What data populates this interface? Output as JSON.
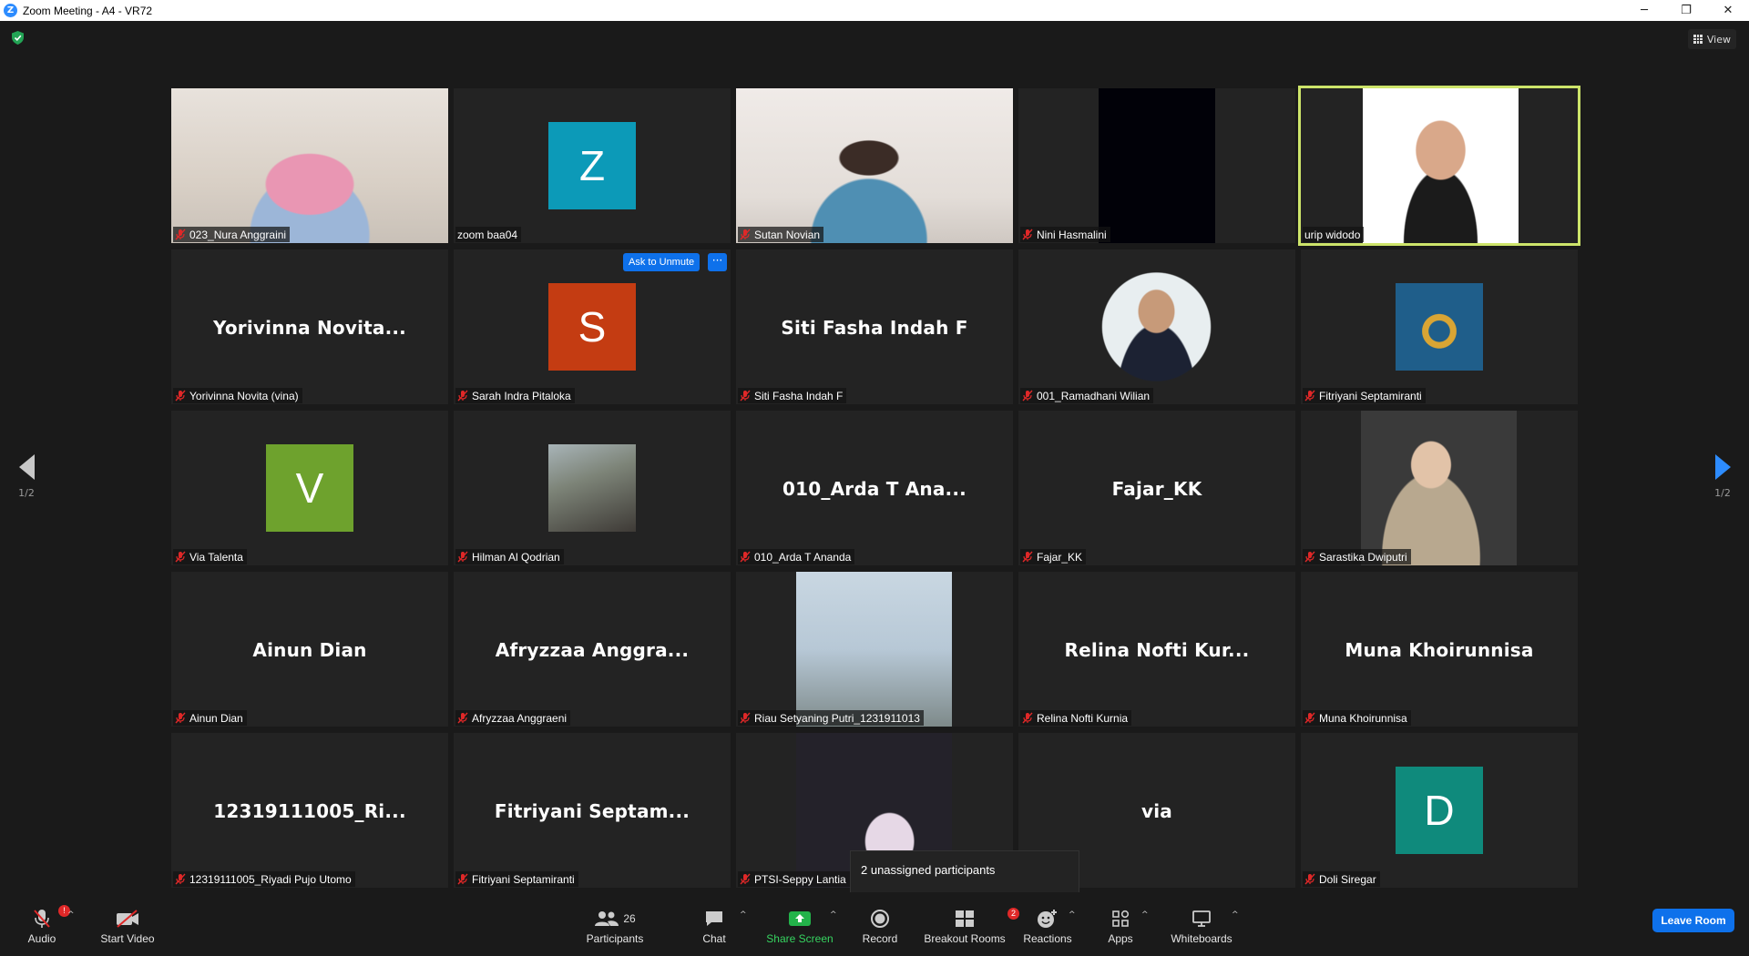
{
  "window": {
    "title": "Zoom Meeting - A4 - VR72",
    "logo_letter": "Z",
    "controls": [
      "─",
      "❐",
      "✕"
    ]
  },
  "view_button": {
    "label": "View"
  },
  "pagination": {
    "left": "1/2",
    "right": "1/2"
  },
  "tiles": [
    {
      "row": 0,
      "col": 0,
      "kind": "photo",
      "label": "023_Nura Anggraini",
      "muted": true
    },
    {
      "row": 0,
      "col": 1,
      "kind": "avatar",
      "letter": "Z",
      "color": "#0c9ab8",
      "label": "zoom baa04",
      "muted": false
    },
    {
      "row": 0,
      "col": 2,
      "kind": "photo",
      "label": "Sutan Novian",
      "muted": true
    },
    {
      "row": 0,
      "col": 3,
      "kind": "photo",
      "label": "Nini Hasmalini",
      "muted": true
    },
    {
      "row": 0,
      "col": 4,
      "kind": "photo",
      "label": "urip widodo",
      "muted": false,
      "active": true
    },
    {
      "row": 1,
      "col": 0,
      "kind": "name",
      "bigname": "Yorivinna  Novita...",
      "label": "Yorivinna Novita (vina)",
      "muted": true
    },
    {
      "row": 1,
      "col": 1,
      "kind": "avatar",
      "letter": "S",
      "color": "#c43c12",
      "label": "Sarah Indra Pitaloka",
      "muted": true
    },
    {
      "row": 1,
      "col": 2,
      "kind": "name",
      "bigname": "Siti Fasha Indah F",
      "label": "Siti Fasha Indah F",
      "muted": true
    },
    {
      "row": 1,
      "col": 3,
      "kind": "photo",
      "label": "001_Ramadhani Wilian",
      "muted": true
    },
    {
      "row": 1,
      "col": 4,
      "kind": "photo",
      "label": "Fitriyani Septamiranti",
      "muted": true
    },
    {
      "row": 2,
      "col": 0,
      "kind": "avatar",
      "letter": "V",
      "color": "#6ea22d",
      "label": "Via Talenta",
      "muted": true
    },
    {
      "row": 2,
      "col": 1,
      "kind": "photo",
      "label": "Hilman Al Qodrian",
      "muted": true
    },
    {
      "row": 2,
      "col": 2,
      "kind": "name",
      "bigname": "010_Arda  T  Ana...",
      "label": "010_Arda T Ananda",
      "muted": true
    },
    {
      "row": 2,
      "col": 3,
      "kind": "name",
      "bigname": "Fajar_KK",
      "label": "Fajar_KK",
      "muted": true
    },
    {
      "row": 2,
      "col": 4,
      "kind": "photo",
      "label": "Sarastika Dwiputri",
      "muted": true
    },
    {
      "row": 3,
      "col": 0,
      "kind": "name",
      "bigname": "Ainun Dian",
      "label": "Ainun Dian",
      "muted": true
    },
    {
      "row": 3,
      "col": 1,
      "kind": "name",
      "bigname": "Afryzzaa  Anggra...",
      "label": "Afryzzaa Anggraeni",
      "muted": true
    },
    {
      "row": 3,
      "col": 2,
      "kind": "photo",
      "label": "Riau Setyaning Putri_1231911013",
      "muted": true
    },
    {
      "row": 3,
      "col": 3,
      "kind": "name",
      "bigname": "Relina  Nofti  Kur...",
      "label": "Relina Nofti Kurnia",
      "muted": true
    },
    {
      "row": 3,
      "col": 4,
      "kind": "name",
      "bigname": "Muna Khoirunnisa",
      "label": "Muna Khoirunnisa",
      "muted": true
    },
    {
      "row": 4,
      "col": 0,
      "kind": "name",
      "bigname": "12319111005_Ri...",
      "label": "12319111005_Riyadi Pujo Utomo",
      "muted": true
    },
    {
      "row": 4,
      "col": 1,
      "kind": "name",
      "bigname": "Fitriyani  Septam...",
      "label": "Fitriyani Septamiranti",
      "muted": true
    },
    {
      "row": 4,
      "col": 2,
      "kind": "photo",
      "label": "PTSI-Seppy Lantia",
      "muted": true
    },
    {
      "row": 4,
      "col": 3,
      "kind": "name",
      "bigname": "via",
      "label": "",
      "muted": false
    },
    {
      "row": 4,
      "col": 4,
      "kind": "avatar",
      "letter": "D",
      "color": "#0f8a7c",
      "label": "Doli Siregar",
      "muted": true
    }
  ],
  "ask_unmute": {
    "label": "Ask to Unmute",
    "more": "···"
  },
  "tooltip": {
    "text": "2 unassigned participants"
  },
  "toolbar": {
    "audio": {
      "label": "Audio",
      "badge": "!"
    },
    "video": {
      "label": "Start Video"
    },
    "participants": {
      "label": "Participants",
      "count": "26"
    },
    "chat": {
      "label": "Chat"
    },
    "share": {
      "label": "Share Screen"
    },
    "record": {
      "label": "Record"
    },
    "breakout": {
      "label": "Breakout Rooms",
      "badge": "2"
    },
    "reactions": {
      "label": "Reactions"
    },
    "apps": {
      "label": "Apps"
    },
    "whiteboards": {
      "label": "Whiteboards"
    },
    "leave": {
      "label": "Leave Room"
    }
  }
}
